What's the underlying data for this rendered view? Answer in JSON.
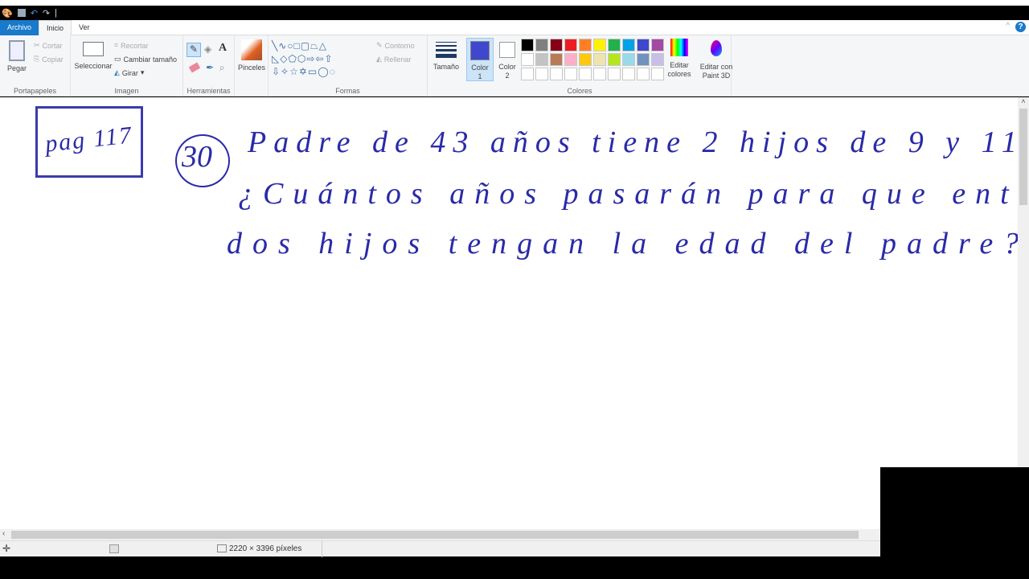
{
  "qat": {
    "separator": "|"
  },
  "tabs": [
    {
      "label": "Archivo"
    },
    {
      "label": "Inicio"
    },
    {
      "label": "Ver"
    }
  ],
  "ribbon": {
    "clipboard": {
      "paste": "Pegar",
      "cut": "Cortar",
      "copy": "Copiar",
      "label": "Portapapeles"
    },
    "image": {
      "select": "Seleccionar",
      "crop": "Recortar",
      "resize": "Cambiar tamaño",
      "rotate": "Girar",
      "label": "Imagen"
    },
    "tools": {
      "label": "Herramientas"
    },
    "brushes": {
      "label": "Pinceles"
    },
    "shapes": {
      "outline": "Contorno",
      "fill": "Rellenar",
      "label": "Formas"
    },
    "size": {
      "label": "Tamaño"
    },
    "colors": {
      "color1": "Color 1",
      "color2": "Color 2",
      "edit": "Editar colores",
      "paint3d": "Editar con Paint 3D",
      "label": "Colores",
      "color1_value": "#3f48cc",
      "color2_value": "#ffffff",
      "palette_row1": [
        "#000000",
        "#7f7f7f",
        "#880015",
        "#ed1c24",
        "#ff7f27",
        "#fff200",
        "#22b14c",
        "#00a2e8",
        "#3f48cc",
        "#a349a4"
      ],
      "palette_row2": [
        "#ffffff",
        "#c3c3c3",
        "#b97a57",
        "#ffaec9",
        "#ffc90e",
        "#efe4b0",
        "#b5e61d",
        "#99d9ea",
        "#7092be",
        "#c8bfe7"
      ]
    }
  },
  "canvas": {
    "box_text": "pag 117",
    "circle_number": "30",
    "line1": "Padre de 43 años tiene 2 hijos de 9 y 11",
    "line2": "¿Cuántos años pasarán para que entre los",
    "line3": "dos hijos tengan la edad del padre?",
    "ink_color": "#2a2aa8"
  },
  "status": {
    "dimensions": "2220 × 3396 píxeles"
  }
}
